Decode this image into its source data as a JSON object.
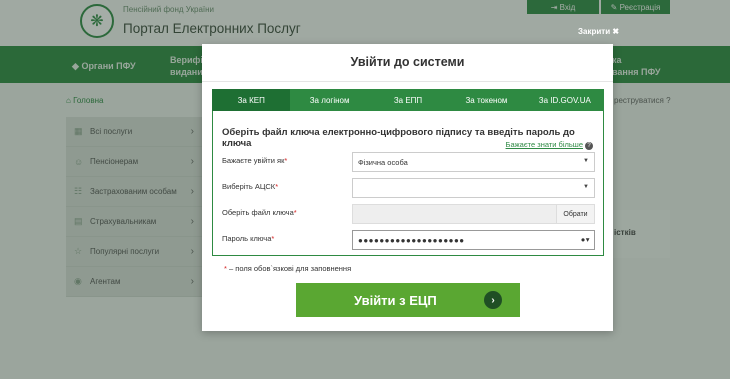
{
  "header": {
    "org": "Пенсійний фонд України",
    "portal": "Портал Електронних Послуг",
    "login": "⇥ Вхід",
    "register": "✎ Реєстрація"
  },
  "nav": {
    "pfu": "Органи ПФУ",
    "verify": "Верифі\nвиданих до",
    "right": "ка\nвання ПФУ"
  },
  "breadcrumb": "Головна",
  "breadcrumb_right": "реструватися",
  "sidebar": {
    "items": [
      {
        "label": "Всі послуги",
        "icon": "grid-icon"
      },
      {
        "label": "Пенсіонерам",
        "icon": "person-icon"
      },
      {
        "label": "Застрахованим особам",
        "icon": "users-icon"
      },
      {
        "label": "Страхувальникам",
        "icon": "briefcase-icon"
      },
      {
        "label": "Популярні послуги",
        "icon": "star-icon"
      },
      {
        "label": "Агентам",
        "icon": "agent-icon"
      }
    ]
  },
  "content_right_text": "істків",
  "close_label": "Закрити ✖",
  "modal": {
    "title": "Увійти до системи",
    "tabs": [
      "За КЕП",
      "За логіном",
      "За ЕПП",
      "За токеном",
      "За ID.GOV.UA"
    ],
    "active_tab": 0,
    "panel_title": "Оберіть файл ключа електронно-цифрового підпису та введіть пароль до ключа",
    "learn_more": "Бажаєте знати більше",
    "fields": {
      "login_as_label": "Бажаєте увійти як",
      "login_as_value": "Фізична особа",
      "acsk_label": "Виберіть АЦСК",
      "acsk_value": "",
      "file_label": "Оберіть файл ключа",
      "file_button": "Обрати",
      "password_label": "Пароль ключа",
      "password_value": "●●●●●●●●●●●●●●●●●●●●"
    },
    "required_note": "– поля обов`язкові для заповнення",
    "submit": "Увійти з ЕЦП"
  },
  "colors": {
    "brand_green": "#2e8a42",
    "active_tab": "#1e6f33",
    "submit_green": "#5aa732",
    "required_red": "#d42020"
  }
}
